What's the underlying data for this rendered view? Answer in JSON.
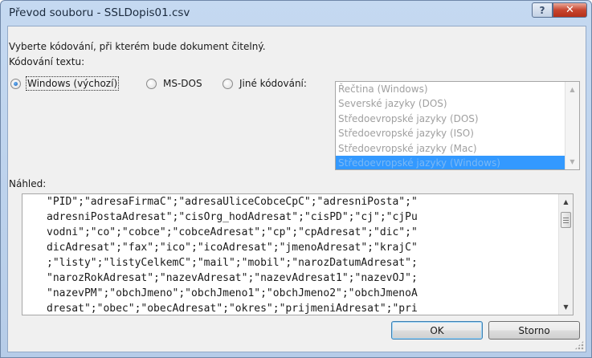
{
  "window": {
    "title": "Převod souboru - SSLDopis01.csv",
    "help_label": "?",
    "close_label": "✕"
  },
  "instruction": "Vyberte kódování, při kterém bude dokument čitelný.",
  "encoding_label": "Kódování textu:",
  "radios": {
    "windows": {
      "label": "Windows (výchozí)",
      "selected": true
    },
    "msdos": {
      "label": "MS-DOS",
      "selected": false
    },
    "other": {
      "label": "Jiné kódování:",
      "selected": false
    }
  },
  "encoding_list": {
    "items": [
      "Řečtina (Windows)",
      "Severské jazyky (DOS)",
      "Středoevropské jazyky (DOS)",
      "Středoevropské jazyky (ISO)",
      "Středoevropské jazyky (Mac)",
      "Středoevropské jazyky (Windows)"
    ],
    "selected": "Středoevropské jazyky (Windows)"
  },
  "preview_label": "Náhled:",
  "preview_lines": [
    "\"PID\";\"adresaFirmaC\";\"adresaUliceCobceCpC\";\"adresniPosta\";\"",
    "adresniPostaAdresat\";\"cisOrg_hodAdresat\";\"cisPD\";\"cj\";\"cjPu",
    "vodni\";\"co\";\"cobce\";\"cobceAdresat\";\"cp\";\"cpAdresat\";\"dic\";\"",
    "dicAdresat\";\"fax\";\"ico\";\"icoAdresat\";\"jmenoAdresat\";\"krajC\"",
    ";\"listy\";\"listyCelkemC\";\"mail\";\"mobil\";\"narozDatumAdresat\";",
    "\"narozRokAdresat\";\"nazevAdresat\";\"nazevAdresat1\";\"nazevOJ\";",
    "\"nazevPM\";\"obchJmeno\";\"obchJmeno1\";\"obchJmeno2\";\"obchJmenoA",
    "dresat\";\"obec\";\"obecAdresat\";\"okres\";\"prijmeniAdresat\";\"pri"
  ],
  "buttons": {
    "ok": "OK",
    "cancel": "Storno"
  }
}
